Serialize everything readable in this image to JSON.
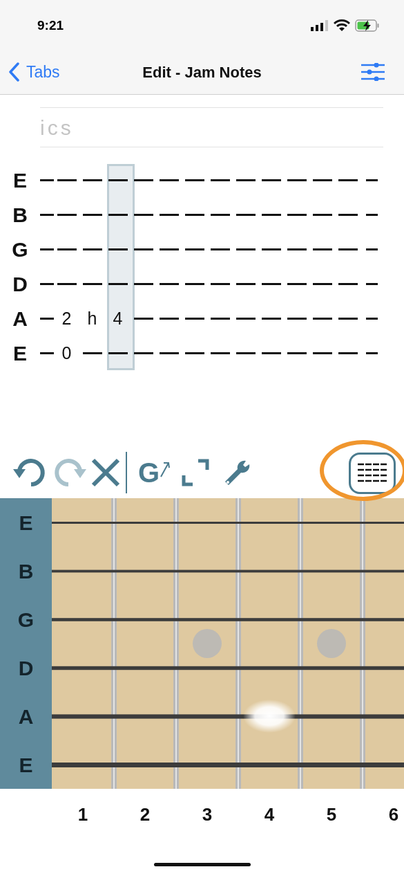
{
  "status_bar": {
    "time": "9:21"
  },
  "nav": {
    "back": "Tabs",
    "title": "Edit - Jam Notes"
  },
  "lyrics": {
    "placeholder": "ics"
  },
  "tab": {
    "columns": [
      {
        "selected": false
      },
      {
        "selected": false
      },
      {
        "selected": true
      },
      {
        "selected": false
      },
      {
        "selected": false
      },
      {
        "selected": false
      },
      {
        "selected": false
      },
      {
        "selected": false
      },
      {
        "selected": false
      },
      {
        "selected": false
      },
      {
        "selected": false
      },
      {
        "selected": false
      }
    ],
    "strings": [
      {
        "name": "E"
      },
      {
        "name": "B"
      },
      {
        "name": "G"
      },
      {
        "name": "D"
      },
      {
        "name": "A",
        "notes": [
          "2",
          "h",
          "4"
        ]
      },
      {
        "name": "E",
        "notes": [
          "0"
        ]
      }
    ]
  },
  "toolbar": [
    {
      "kind": "undo",
      "disabled": false
    },
    {
      "kind": "redo",
      "disabled": true
    },
    {
      "kind": "clear",
      "disabled": false
    },
    {
      "kind": "divider"
    },
    {
      "kind": "chord",
      "label": "G",
      "disabled": false
    },
    {
      "kind": "expand",
      "disabled": false
    },
    {
      "kind": "tools",
      "disabled": false
    }
  ],
  "view_button": {
    "highlighted": true
  },
  "fretboard": {
    "strings": [
      {
        "name": "E",
        "glowing": false
      },
      {
        "name": "B",
        "glowing": false
      },
      {
        "name": "G",
        "glowing": false
      },
      {
        "name": "D",
        "glowing": false
      },
      {
        "name": "A",
        "glowing": true
      },
      {
        "name": "E",
        "glowing": false
      }
    ],
    "frets": [
      {
        "label": "1",
        "inlay": false,
        "glowing": false
      },
      {
        "label": "2",
        "inlay": false,
        "glowing": false
      },
      {
        "label": "3",
        "inlay": true,
        "glowing": false
      },
      {
        "label": "4",
        "inlay": false,
        "glowing": true
      },
      {
        "label": "5",
        "inlay": true,
        "glowing": false
      },
      {
        "label": "6",
        "inlay": false,
        "glowing": false
      }
    ]
  }
}
